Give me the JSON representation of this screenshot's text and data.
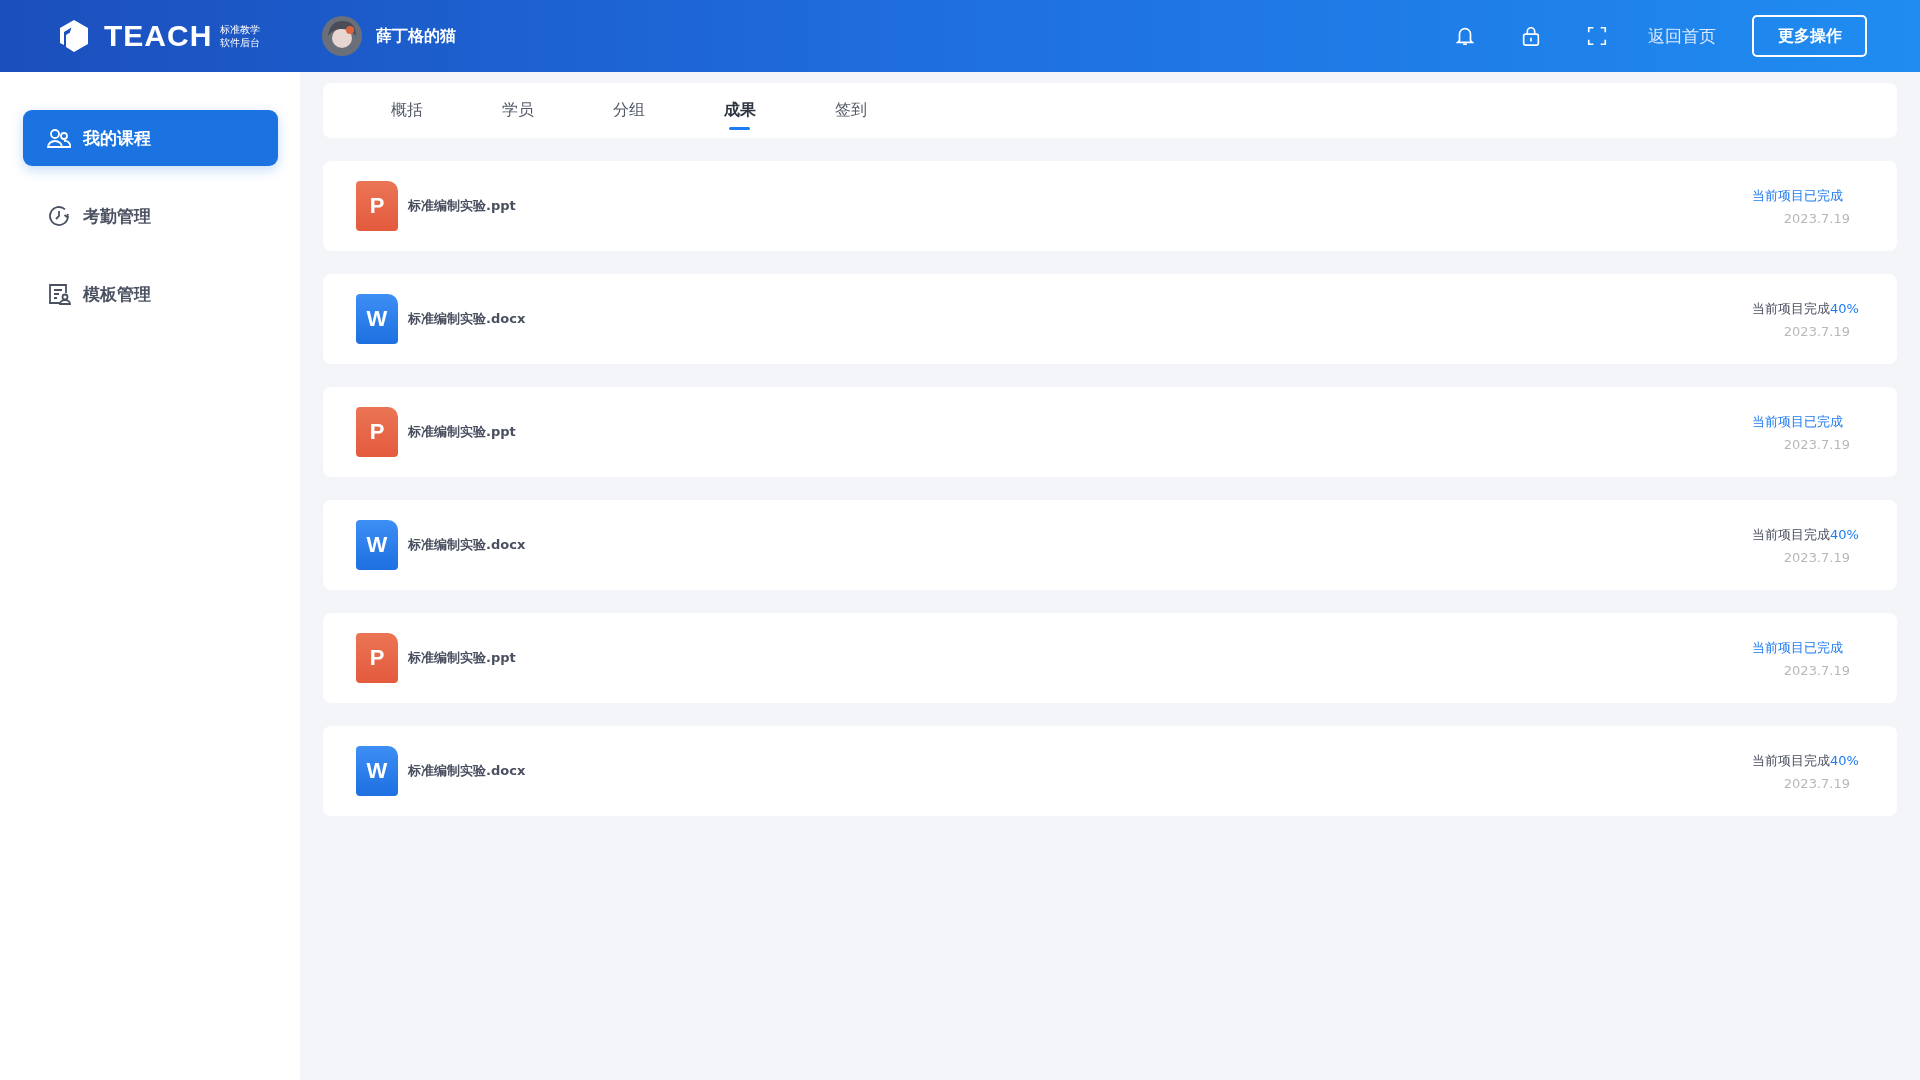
{
  "header": {
    "logo_text": "TEACH",
    "logo_sub": [
      "标准教学",
      "软件后台"
    ],
    "user_name": "薛丁格的猫",
    "home_link": "返回首页",
    "more_button": "更多操作"
  },
  "sidebar": {
    "items": [
      {
        "label": "我的课程",
        "kind": "users",
        "selected": true
      },
      {
        "label": "考勤管理",
        "kind": "clock",
        "selected": false
      },
      {
        "label": "模板管理",
        "kind": "doc",
        "selected": false
      }
    ]
  },
  "tabs": [
    {
      "label": "概括",
      "selected": false
    },
    {
      "label": "学员",
      "selected": false
    },
    {
      "label": "分组",
      "selected": false
    },
    {
      "label": "成果",
      "selected": true
    },
    {
      "label": "签到",
      "selected": false
    }
  ],
  "files": [
    {
      "kind": "ppt",
      "badge": "P",
      "name": "标准编制实验.ppt",
      "status": {
        "kind": "done",
        "text": "当前项目已完成"
      },
      "date": "2023.7.19"
    },
    {
      "kind": "doc",
      "badge": "W",
      "name": "标准编制实验.docx",
      "status": {
        "kind": "progress",
        "text": "当前项目完成",
        "percent": "40%"
      },
      "date": "2023.7.19"
    },
    {
      "kind": "ppt",
      "badge": "P",
      "name": "标准编制实验.ppt",
      "status": {
        "kind": "done",
        "text": "当前项目已完成"
      },
      "date": "2023.7.19"
    },
    {
      "kind": "doc",
      "badge": "W",
      "name": "标准编制实验.docx",
      "status": {
        "kind": "progress",
        "text": "当前项目完成",
        "percent": "40%"
      },
      "date": "2023.7.19"
    },
    {
      "kind": "ppt",
      "badge": "P",
      "name": "标准编制实验.ppt",
      "status": {
        "kind": "done",
        "text": "当前项目已完成"
      },
      "date": "2023.7.19"
    },
    {
      "kind": "doc",
      "badge": "W",
      "name": "标准编制实验.docx",
      "status": {
        "kind": "progress",
        "text": "当前项目完成",
        "percent": "40%"
      },
      "date": "2023.7.19"
    }
  ]
}
